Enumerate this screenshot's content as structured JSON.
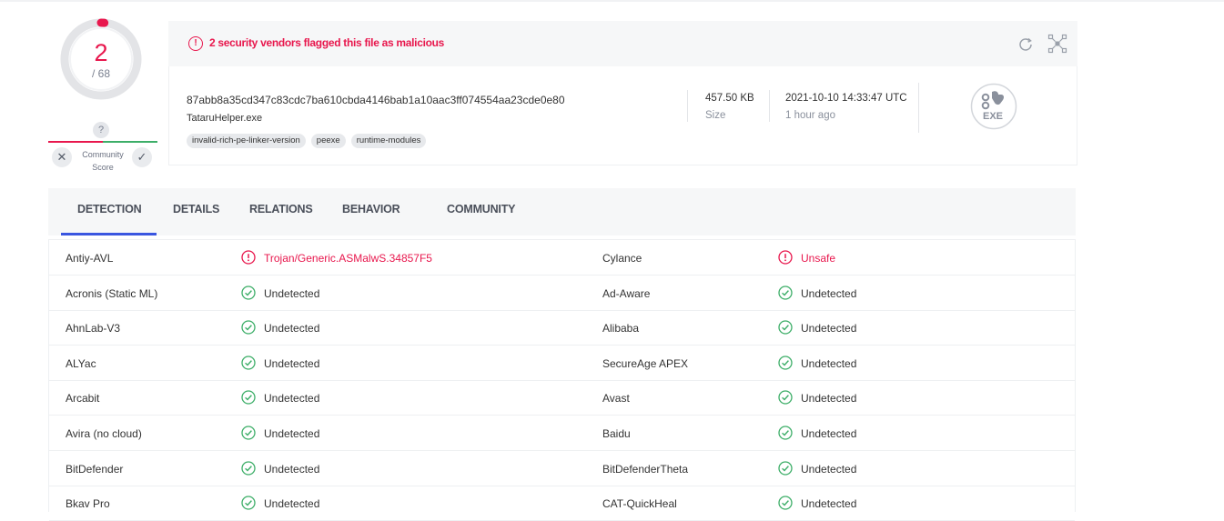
{
  "score": {
    "detections": "2",
    "total": "/ 68",
    "community_unknown": "?",
    "community_label": "Community\nScore"
  },
  "alert": {
    "icon_glyph": "!",
    "text": "2 security vendors flagged this file as malicious"
  },
  "file": {
    "hash": "87abb8a35cd347c83cdc7ba610cbda4146bab1a10aac3ff074554aa23cde0e80",
    "name": "TataruHelper.exe",
    "tags": [
      "invalid-rich-pe-linker-version",
      "peexe",
      "runtime-modules"
    ],
    "size": "457.50 KB",
    "size_label": "Size",
    "date": "2021-10-10 14:33:47 UTC",
    "date_ago": "1 hour ago",
    "type_label": "EXE"
  },
  "tabs": [
    {
      "label": "DETECTION",
      "active": true
    },
    {
      "label": "DETAILS",
      "active": false
    },
    {
      "label": "RELATIONS",
      "active": false
    },
    {
      "label": "BEHAVIOR",
      "active": false
    },
    {
      "label": "COMMUNITY",
      "active": false
    }
  ],
  "detections": [
    {
      "engine_a": "Antiy-AVL",
      "result_a": "Trojan/Generic.ASMalwS.34857F5",
      "status_a": "malicious",
      "engine_b": "Cylance",
      "result_b": "Unsafe",
      "status_b": "malicious"
    },
    {
      "engine_a": "Acronis (Static ML)",
      "result_a": "Undetected",
      "status_a": "clean",
      "engine_b": "Ad-Aware",
      "result_b": "Undetected",
      "status_b": "clean"
    },
    {
      "engine_a": "AhnLab-V3",
      "result_a": "Undetected",
      "status_a": "clean",
      "engine_b": "Alibaba",
      "result_b": "Undetected",
      "status_b": "clean"
    },
    {
      "engine_a": "ALYac",
      "result_a": "Undetected",
      "status_a": "clean",
      "engine_b": "SecureAge APEX",
      "result_b": "Undetected",
      "status_b": "clean"
    },
    {
      "engine_a": "Arcabit",
      "result_a": "Undetected",
      "status_a": "clean",
      "engine_b": "Avast",
      "result_b": "Undetected",
      "status_b": "clean"
    },
    {
      "engine_a": "Avira (no cloud)",
      "result_a": "Undetected",
      "status_a": "clean",
      "engine_b": "Baidu",
      "result_b": "Undetected",
      "status_b": "clean"
    },
    {
      "engine_a": "BitDefender",
      "result_a": "Undetected",
      "status_a": "clean",
      "engine_b": "BitDefenderTheta",
      "result_b": "Undetected",
      "status_b": "clean"
    },
    {
      "engine_a": "Bkav Pro",
      "result_a": "Undetected",
      "status_a": "clean",
      "engine_b": "CAT-QuickHeal",
      "result_b": "Undetected",
      "status_b": "clean"
    }
  ],
  "colors": {
    "malicious": "#e8174d",
    "clean": "#3dae68",
    "accent": "#3a56e0"
  },
  "icons": {
    "reanalyze": "refresh-icon",
    "graph": "graph-icon",
    "filetype": "exe-file-icon",
    "malicious": "alert-circle-icon",
    "clean": "check-circle-icon"
  }
}
